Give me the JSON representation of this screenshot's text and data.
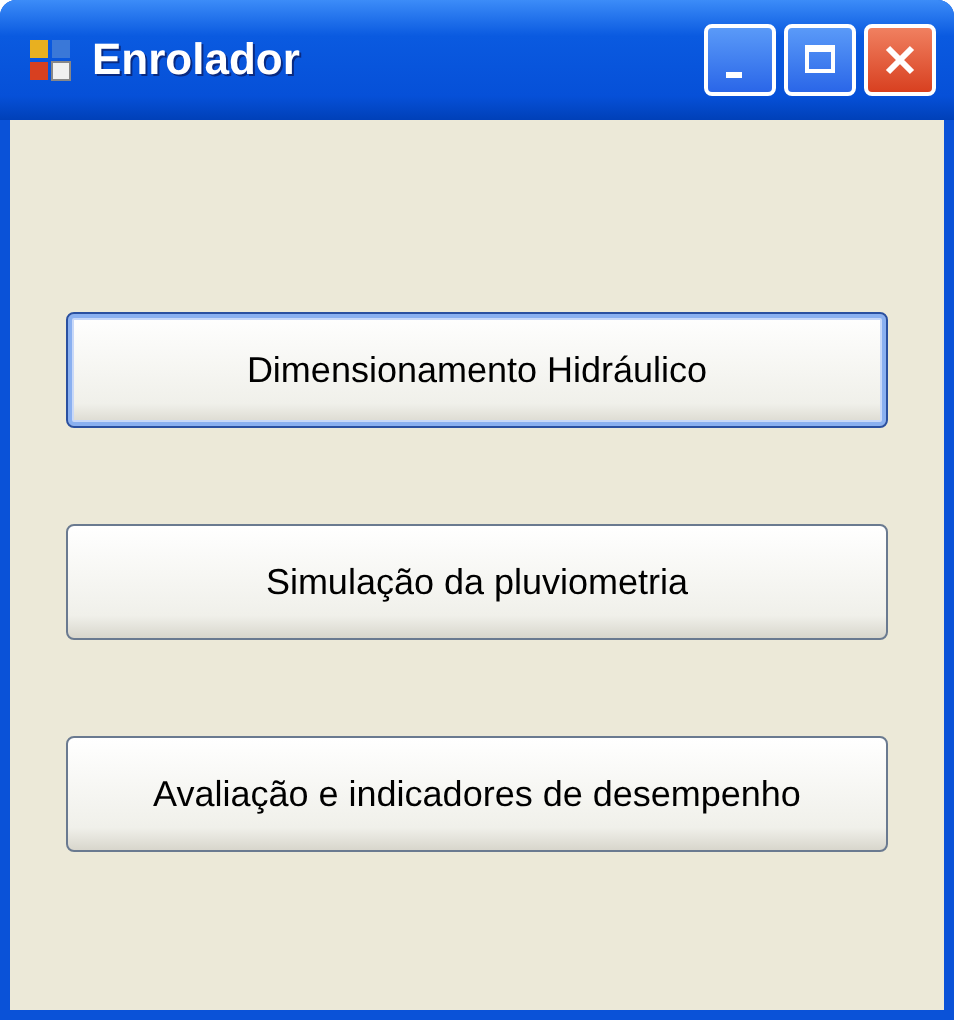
{
  "window": {
    "title": "Enrolador"
  },
  "buttons": [
    {
      "label": "Dimensionamento Hidráulico",
      "focused": true
    },
    {
      "label": "Simulação da pluviometria",
      "focused": false
    },
    {
      "label": "Avaliação e indicadores de desempenho",
      "focused": false
    }
  ]
}
